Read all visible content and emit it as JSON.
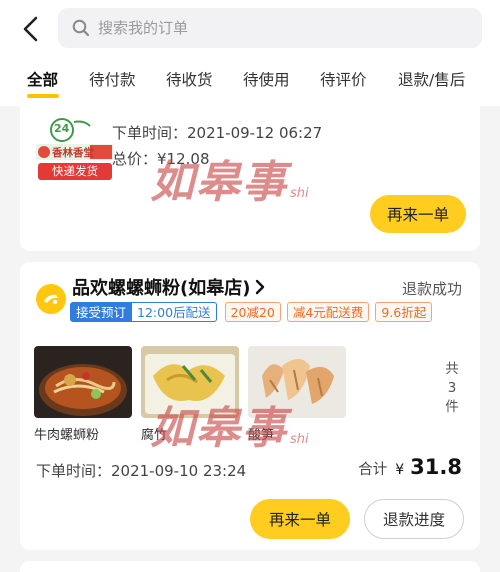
{
  "search": {
    "placeholder": "搜索我的订单"
  },
  "tabs": [
    {
      "label": "全部",
      "active": true
    },
    {
      "label": "待付款"
    },
    {
      "label": "待收货"
    },
    {
      "label": "待使用"
    },
    {
      "label": "待评价"
    },
    {
      "label": "退款/售后"
    }
  ],
  "order1": {
    "logo_badge": "24",
    "logo_text": "香林香堂",
    "logo_ribbon": "快递发货",
    "order_time": "下单时间：2021-09-12 06:27",
    "total_price": "总价：¥12.08",
    "reorder_label": "再来一单"
  },
  "order2": {
    "store_name": "品欢螺螺蛳粉(如皋店)",
    "status": "退款成功",
    "tags": [
      "接受预订",
      "12:00后配送",
      "20减20",
      "减4元配送费",
      "9.6折起"
    ],
    "items": [
      {
        "name": "牛肉螺蛳粉"
      },
      {
        "name": "腐竹"
      },
      {
        "name": "酸笋"
      }
    ],
    "item_count_chars": [
      "共",
      "3",
      "件"
    ],
    "order_time": "下单时间：2021-09-10 23:24",
    "total_label": "合计",
    "currency": "¥",
    "total_value": "31.8",
    "reorder_label": "再来一单",
    "refund_progress_label": "退款进度"
  },
  "watermark": {
    "text": "如皋事",
    "suffix": "shi"
  },
  "colors": {
    "accent": "#ffcd1f",
    "tag_blue": "#2f7de1",
    "tag_orange": "#f06a1e"
  }
}
